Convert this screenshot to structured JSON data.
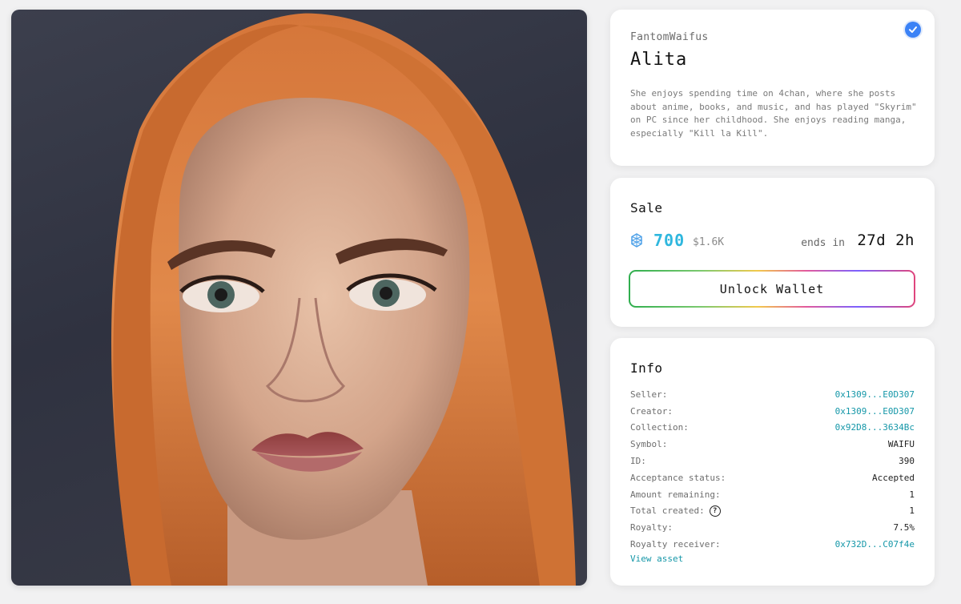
{
  "asset": {
    "collection": "FantomWaifus",
    "title": "Alita",
    "description": "She enjoys spending time on 4chan, where she posts about anime, books, and music, and has played \"Skyrim\" on PC since her childhood. She enjoys reading manga, especially \"Kill la Kill\".",
    "verified_icon": "check-circle-icon",
    "image_icon": "portrait-artwork"
  },
  "sale": {
    "heading": "Sale",
    "currency_icon": "fantom-coin-icon",
    "price": "700",
    "price_usd": "$1.6K",
    "ends_label": "ends in",
    "ends_value": "27d 2h",
    "button_label": "Unlock Wallet"
  },
  "info": {
    "heading": "Info",
    "rows": [
      {
        "label": "Seller:",
        "value": "0x1309...E0D307",
        "link": true
      },
      {
        "label": "Creator:",
        "value": "0x1309...E0D307",
        "link": true
      },
      {
        "label": "Collection:",
        "value": "0x92D8...3634Bc",
        "link": true
      },
      {
        "label": "Symbol:",
        "value": "WAIFU",
        "link": false
      },
      {
        "label": "ID:",
        "value": "390",
        "link": false
      },
      {
        "label": "Acceptance status:",
        "value": "Accepted",
        "link": false
      },
      {
        "label": "Amount remaining:",
        "value": "1",
        "link": false
      },
      {
        "label": "Total created:",
        "value": "1",
        "link": false,
        "help": true
      },
      {
        "label": "Royalty:",
        "value": "7.5%",
        "link": false
      },
      {
        "label": "Royalty receiver:",
        "value": "0x732D...C07f4e",
        "link": true
      }
    ],
    "view_asset_label": "View asset"
  },
  "colors": {
    "accent": "#2fb7de",
    "link": "#1597a8",
    "verified": "#3b82f6"
  }
}
